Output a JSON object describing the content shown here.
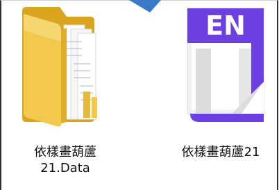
{
  "files": [
    {
      "name_line1": "依樣畫葫蘆",
      "name_line2": "21.Data",
      "icon": "folder-icon"
    },
    {
      "name_line1": "依樣畫葫蘆21",
      "icon": "en-document-icon",
      "badge": "EN"
    }
  ],
  "colors": {
    "folder": "#f2c94c",
    "folder_dark": "#d9a521",
    "en_accent": "#6b3fe0",
    "arrow": "#3a78c9"
  }
}
